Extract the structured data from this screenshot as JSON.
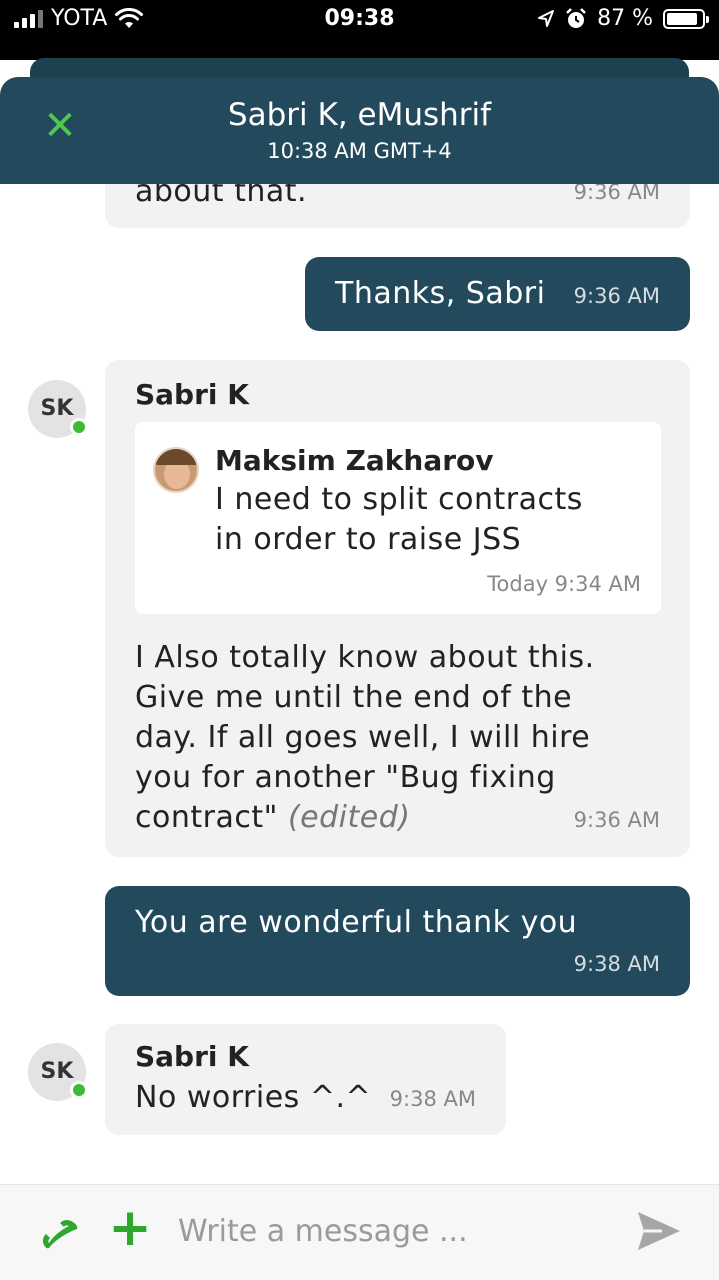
{
  "status_bar": {
    "carrier": "YOTA",
    "time": "09:38",
    "battery": "87 %",
    "battery_level": 0.87
  },
  "header": {
    "title": "Sabri K, eMushrif",
    "subtitle": "10:38 AM GMT+4",
    "close_icon": "close-icon"
  },
  "messages": [
    {
      "direction": "incoming",
      "text": "about that.",
      "time": "9:36 AM"
    },
    {
      "direction": "outgoing",
      "text": "Thanks, Sabri",
      "time": "9:36 AM"
    },
    {
      "direction": "incoming",
      "avatar": "SK",
      "sender": "Sabri K",
      "quote": {
        "author": "Maksim Zakharov",
        "line1": "I need to split contracts",
        "line2": "in order to raise JSS",
        "time": "Today 9:34 AM"
      },
      "lines": [
        "I Also totally know about this.",
        "Give me until the end of the",
        "day. If all goes well, I will hire",
        "you for another \"Bug fixing",
        "contract\""
      ],
      "edited": "(edited)",
      "time": "9:36 AM"
    },
    {
      "direction": "outgoing",
      "text": "You are wonderful thank you",
      "time": "9:38 AM"
    },
    {
      "direction": "incoming",
      "avatar": "SK",
      "sender": "Sabri K",
      "text": "No worries ^.^",
      "time": "9:38 AM"
    }
  ],
  "composer": {
    "placeholder": "Write a message ...",
    "call_icon": "phone-icon",
    "attach_icon": "plus-icon",
    "send_icon": "send-icon"
  },
  "colors": {
    "header_bg": "#234a5c",
    "outgoing_bubble": "#234a5c",
    "incoming_bubble": "#f2f2f2",
    "accent_green": "#2da82a",
    "online_dot": "#3dbb32"
  }
}
